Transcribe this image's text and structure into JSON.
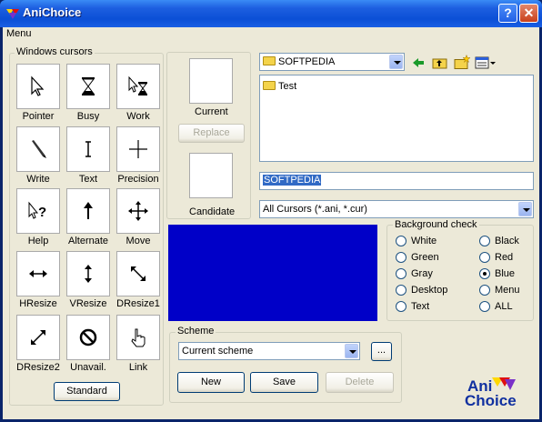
{
  "window": {
    "title": "AniChoice"
  },
  "menubar": {
    "menu_label": "Menu"
  },
  "cursors_group": {
    "label": "Windows cursors",
    "items": [
      {
        "label": "Pointer",
        "icon": "pointer-icon"
      },
      {
        "label": "Busy",
        "icon": "hourglass-icon"
      },
      {
        "label": "Work",
        "icon": "pointer-hourglass-icon"
      },
      {
        "label": "Write",
        "icon": "pen-icon"
      },
      {
        "label": "Text",
        "icon": "text-beam-icon"
      },
      {
        "label": "Precision",
        "icon": "crosshair-icon"
      },
      {
        "label": "Help",
        "icon": "help-pointer-icon"
      },
      {
        "label": "Alternate",
        "icon": "up-arrow-icon"
      },
      {
        "label": "Move",
        "icon": "move-icon"
      },
      {
        "label": "HResize",
        "icon": "horizontal-resize-icon"
      },
      {
        "label": "VResize",
        "icon": "vertical-resize-icon"
      },
      {
        "label": "DResize1",
        "icon": "diagonal-resize-1-icon"
      },
      {
        "label": "DResize2",
        "icon": "diagonal-resize-2-icon"
      },
      {
        "label": "Unavail.",
        "icon": "unavailable-icon"
      },
      {
        "label": "Link",
        "icon": "hand-icon"
      }
    ],
    "standard_label": "Standard"
  },
  "preview": {
    "current_label": "Current",
    "replace_label": "Replace",
    "candidate_label": "Candidate"
  },
  "browser": {
    "folder_value": "SOFTPEDIA",
    "list_items": [
      "Test"
    ],
    "filename_value": "SOFTPEDIA",
    "filter_value": "All Cursors (*.ani, *.cur)"
  },
  "background_check": {
    "label": "Background check",
    "options": [
      {
        "label": "White",
        "checked": false
      },
      {
        "label": "Black",
        "checked": false
      },
      {
        "label": "Green",
        "checked": false
      },
      {
        "label": "Red",
        "checked": false
      },
      {
        "label": "Gray",
        "checked": false
      },
      {
        "label": "Blue",
        "checked": true
      },
      {
        "label": "Desktop",
        "checked": false
      },
      {
        "label": "Menu",
        "checked": false
      },
      {
        "label": "Text",
        "checked": false
      },
      {
        "label": "ALL",
        "checked": false
      }
    ],
    "preview_color": "#0000c8"
  },
  "scheme": {
    "label": "Scheme",
    "value": "Current scheme",
    "browse_label": "...",
    "new_label": "New",
    "save_label": "Save",
    "delete_label": "Delete"
  },
  "logo": {
    "line1": "Ani",
    "line2": "Choice"
  }
}
